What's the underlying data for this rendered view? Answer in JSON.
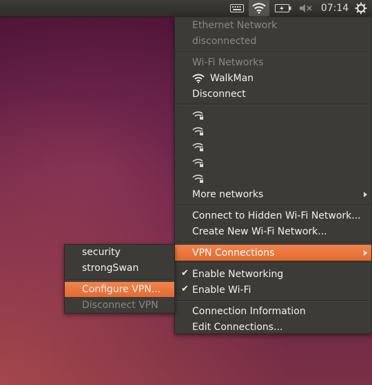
{
  "topbar": {
    "clock": "07:14",
    "indicators": [
      "keyboard-icon",
      "wifi-icon",
      "battery-icon",
      "sound-muted-icon",
      "gear-icon"
    ]
  },
  "network_menu": {
    "ethernet_header": "Ethernet Network",
    "ethernet_status": "disconnected",
    "wifi_header": "Wi-Fi Networks",
    "connected_network": "WalkMan",
    "disconnect": "Disconnect",
    "more_networks": "More networks",
    "connect_hidden": "Connect to Hidden Wi-Fi Network...",
    "create_new": "Create New Wi-Fi Network...",
    "vpn_connections": "VPN Connections",
    "enable_networking": "Enable Networking",
    "enable_wifi": "Enable Wi-Fi",
    "connection_information": "Connection Information",
    "edit_connections": "Edit Connections..."
  },
  "vpn_submenu": {
    "items": [
      "security",
      "strongSwan"
    ],
    "configure": "Configure VPN...",
    "disconnect": "Disconnect VPN"
  },
  "colors": {
    "highlight": "#e96d33",
    "menu_bg": "#3c3b37",
    "panel_bg": "#2e2d29"
  }
}
